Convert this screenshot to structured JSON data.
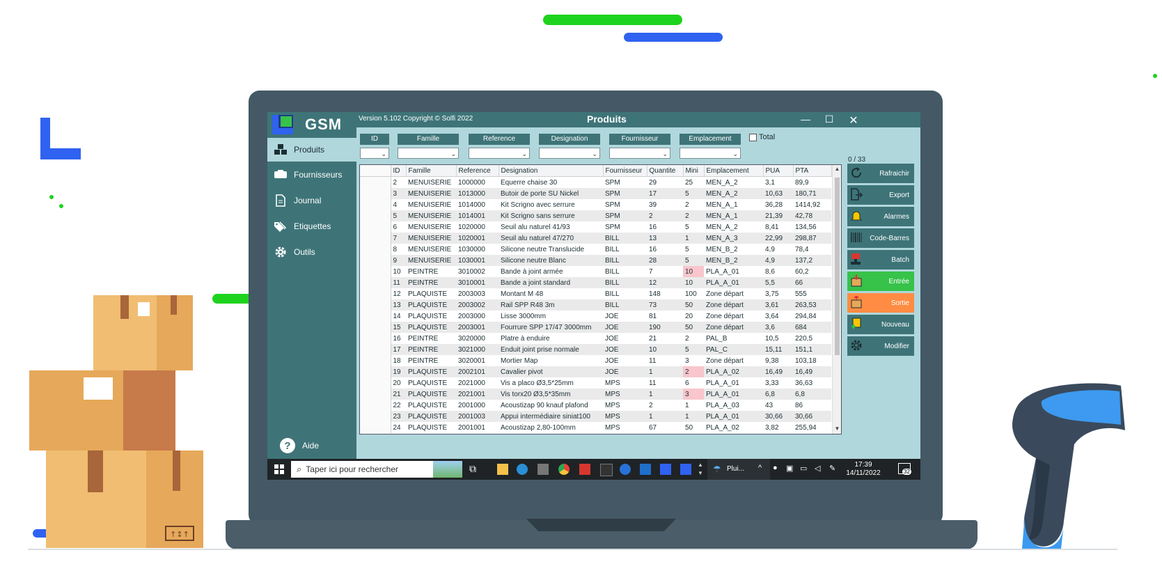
{
  "app": {
    "logo": "GSM",
    "version": "Version 5.102  Copyright © Solfi 2022",
    "window_title": "Produits",
    "help_label": "Aide"
  },
  "sidebar": {
    "items": [
      {
        "label": "Produits",
        "icon": "cubes-icon"
      },
      {
        "label": "Fournisseurs",
        "icon": "truck-box-icon"
      },
      {
        "label": "Journal",
        "icon": "document-icon"
      },
      {
        "label": "Etiquettes",
        "icon": "tags-icon"
      },
      {
        "label": "Outils",
        "icon": "gear-icon"
      }
    ]
  },
  "filters": {
    "labels": [
      "ID",
      "Famille",
      "Reference",
      "Designation",
      "Fournisseur",
      "Emplacement"
    ],
    "total_label": "Total"
  },
  "count": "0 / 33",
  "table": {
    "headers": [
      "ID",
      "Famille",
      "Reference",
      "Designation",
      "Fournisseur",
      "Quantite",
      "Mini",
      "Emplacement",
      "PUA",
      "PTA"
    ],
    "rows": [
      [
        "2",
        "MENUISERIE",
        "1000000",
        "Equerre chaise 30",
        "SPM",
        "29",
        "25",
        "MEN_A_2",
        "3,1",
        "89,9"
      ],
      [
        "3",
        "MENUISERIE",
        "1013000",
        "Butoir de porte SU Nickel",
        "SPM",
        "17",
        "5",
        "MEN_A_2",
        "10,63",
        "180,71"
      ],
      [
        "4",
        "MENUISERIE",
        "1014000",
        "Kit Scrigno avec serrure",
        "SPM",
        "39",
        "2",
        "MEN_A_1",
        "36,28",
        "1414,92"
      ],
      [
        "5",
        "MENUISERIE",
        "1014001",
        "Kit Scrigno sans serrure",
        "SPM",
        "2",
        "2",
        "MEN_A_1",
        "21,39",
        "42,78"
      ],
      [
        "6",
        "MENUISERIE",
        "1020000",
        "Seuil alu naturel 41/93",
        "SPM",
        "16",
        "5",
        "MEN_A_2",
        "8,41",
        "134,56"
      ],
      [
        "7",
        "MENUISERIE",
        "1020001",
        "Seuil alu naturel 47/270",
        "BILL",
        "13",
        "1",
        "MEN_A_3",
        "22,99",
        "298,87"
      ],
      [
        "8",
        "MENUISERIE",
        "1030000",
        "Silicone neutre Translucide",
        "BILL",
        "16",
        "5",
        "MEN_B_2",
        "4,9",
        "78,4"
      ],
      [
        "9",
        "MENUISERIE",
        "1030001",
        "Silicone neutre Blanc",
        "BILL",
        "28",
        "5",
        "MEN_B_2",
        "4,9",
        "137,2"
      ],
      [
        "10",
        "PEINTRE",
        "3010002",
        "Bande à joint armée",
        "BILL",
        "7",
        "10",
        "PLA_A_01",
        "8,6",
        "60,2"
      ],
      [
        "11",
        "PEINTRE",
        "3010001",
        "Bande a joint standard",
        "BILL",
        "12",
        "10",
        "PLA_A_01",
        "5,5",
        "66"
      ],
      [
        "12",
        "PLAQUISTE",
        "2003003",
        "Montant M 48",
        "BILL",
        "148",
        "100",
        "Zone départ",
        "3,75",
        "555"
      ],
      [
        "13",
        "PLAQUISTE",
        "2003002",
        "Rail SPP R48 3m",
        "BILL",
        "73",
        "50",
        "Zone départ",
        "3,61",
        "263,53"
      ],
      [
        "14",
        "PLAQUISTE",
        "2003000",
        "Lisse 3000mm",
        "JOE",
        "81",
        "20",
        "Zone départ",
        "3,64",
        "294,84"
      ],
      [
        "15",
        "PLAQUISTE",
        "2003001",
        "Fourrure SPP 17/47 3000mm",
        "JOE",
        "190",
        "50",
        "Zone départ",
        "3,6",
        "684"
      ],
      [
        "16",
        "PEINTRE",
        "3020000",
        "Platre à enduire",
        "JOE",
        "21",
        "2",
        "PAL_B",
        "10,5",
        "220,5"
      ],
      [
        "17",
        "PEINTRE",
        "3021000",
        "Enduit joint prise normale",
        "JOE",
        "10",
        "5",
        "PAL_C",
        "15,11",
        "151,1"
      ],
      [
        "18",
        "PEINTRE",
        "3020001",
        "Mortier Map",
        "JOE",
        "11",
        "3",
        "Zone départ",
        "9,38",
        "103,18"
      ],
      [
        "19",
        "PLAQUISTE",
        "2002101",
        "Cavalier pivot",
        "JOE",
        "1",
        "2",
        "PLA_A_02",
        "16,49",
        "16,49"
      ],
      [
        "20",
        "PLAQUISTE",
        "2021000",
        "Vis a placo Ø3,5*25mm",
        "MPS",
        "11",
        "6",
        "PLA_A_01",
        "3,33",
        "36,63"
      ],
      [
        "21",
        "PLAQUISTE",
        "2021001",
        "Vis torx20 Ø3,5*35mm",
        "MPS",
        "1",
        "3",
        "PLA_A_01",
        "6,8",
        "6,8"
      ],
      [
        "22",
        "PLAQUISTE",
        "2001000",
        "Acoustizap 90 knauf plafond",
        "MPS",
        "2",
        "1",
        "PLA_A_03",
        "43",
        "86"
      ],
      [
        "23",
        "PLAQUISTE",
        "2001003",
        "Appui intermédiaire siniat100",
        "MPS",
        "1",
        "1",
        "PLA_A_01",
        "30,66",
        "30,66"
      ],
      [
        "24",
        "PLAQUISTE",
        "2001001",
        "Acoustizap 2,80-100mm",
        "MPS",
        "67",
        "50",
        "PLA_A_02",
        "3,82",
        "255,94"
      ]
    ],
    "alert_mini_rows": [
      8,
      17,
      19
    ]
  },
  "actions": [
    {
      "label": "Rafraichir",
      "icon": "refresh-icon",
      "style": "teal"
    },
    {
      "label": "Export",
      "icon": "export-icon",
      "style": "teal"
    },
    {
      "label": "Alarmes",
      "icon": "bell-icon",
      "style": "teal"
    },
    {
      "label": "Code-Barres",
      "icon": "barcode-icon",
      "style": "teal"
    },
    {
      "label": "Batch",
      "icon": "stamp-icon",
      "style": "teal"
    },
    {
      "label": "Entrée",
      "icon": "box-in-icon",
      "style": "green"
    },
    {
      "label": "Sortie",
      "icon": "box-out-icon",
      "style": "orange"
    },
    {
      "label": "Nouveau",
      "icon": "new-icon",
      "style": "teal"
    },
    {
      "label": "Modifier",
      "icon": "gear-icon",
      "style": "teal"
    }
  ],
  "taskbar": {
    "search_placeholder": "Taper ici pour rechercher",
    "weather": "Plui...",
    "time": "17:39",
    "date": "14/11/2022",
    "notifications": "32"
  },
  "colors": {
    "teal": "#3e7478",
    "panel": "#b0d7dc",
    "green": "#37c24a",
    "orange": "#ff8c42",
    "alert": "#f8c6cc",
    "laptop": "#445965"
  }
}
